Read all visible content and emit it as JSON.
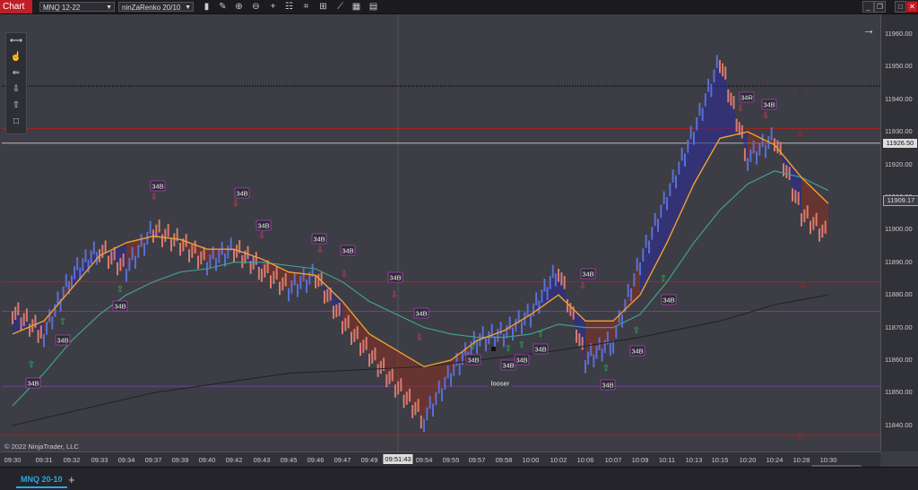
{
  "toolbar": {
    "chart_tab": "Chart",
    "instrument": "MNQ 12-22",
    "bar_type": "ninZaRenko 20/10"
  },
  "icons": [
    "bars-icon",
    "pencil-icon",
    "zoom-in-icon",
    "zoom-out-icon",
    "crosshair-icon",
    "properties-icon",
    "indicators-icon",
    "strategies-icon",
    "drawing-tools-icon",
    "templates-icon",
    "data-box-icon"
  ],
  "window": {
    "minimize": "_",
    "restore": "❐",
    "maximize": "□",
    "close": "✕"
  },
  "drawing_tools": [
    "line-tool-icon",
    "hand-tool-icon",
    "horizontal-line-icon",
    "arrow-down-icon",
    "arrow-up-icon",
    "rectangle-icon"
  ],
  "price_axis": {
    "labels": [
      "11960.00",
      "11950.00",
      "11940.00",
      "11930.00",
      "11920.00",
      "11910.00",
      "11900.00",
      "11890.00",
      "11880.00",
      "11870.00",
      "11860.00",
      "11850.00",
      "11840.00"
    ],
    "crosshair_price": "11926.50",
    "current_price": "11909.17"
  },
  "time_axis": {
    "labels": [
      "09:30",
      "09:31",
      "09:32",
      "09:33",
      "09:34",
      "09:37",
      "09:39",
      "09:40",
      "09:42",
      "09:43",
      "09:45",
      "09:46",
      "09:47",
      "09:49",
      "09:54",
      "09:55",
      "09:57",
      "09:58",
      "10:00",
      "10:02",
      "10:06",
      "10:07",
      "10:09",
      "10:11",
      "10:13",
      "10:15",
      "10:20",
      "10:24",
      "10:28",
      "10:30"
    ],
    "crosshair_time": "09:51:43"
  },
  "signal_labels": [
    "34B",
    "34R",
    "looser"
  ],
  "line_labels": [
    "R",
    "R",
    "R",
    "R"
  ],
  "copyright": "© 2022 NinjaTrader, LLC",
  "f_label": "F",
  "bottom_tab": "MNQ 20-10",
  "add_tab": "+",
  "chart_data": {
    "type": "line",
    "x": [
      "09:30",
      "09:31",
      "09:32",
      "09:33",
      "09:34",
      "09:37",
      "09:39",
      "09:40",
      "09:42",
      "09:43",
      "09:45",
      "09:46",
      "09:47",
      "09:49",
      "09:54",
      "09:55",
      "09:57",
      "09:58",
      "10:00",
      "10:02",
      "10:06",
      "10:07",
      "10:09",
      "10:11",
      "10:13",
      "10:15",
      "10:20",
      "10:24",
      "10:28",
      "10:30"
    ],
    "ylim": [
      11832,
      11966
    ],
    "price": [
      [
        "09:30",
        11875
      ],
      [
        "09:31",
        11868
      ],
      [
        "09:32",
        11886
      ],
      [
        "09:33",
        11894
      ],
      [
        "09:34",
        11888
      ],
      [
        "09:37",
        11900
      ],
      [
        "09:39",
        11896
      ],
      [
        "09:40",
        11890
      ],
      [
        "09:42",
        11894
      ],
      [
        "09:43",
        11888
      ],
      [
        "09:45",
        11882
      ],
      [
        "09:46",
        11886
      ],
      [
        "09:47",
        11872
      ],
      [
        "09:49",
        11862
      ],
      [
        "09:54",
        11842
      ],
      [
        "09:55",
        11856
      ],
      [
        "09:57",
        11866
      ],
      [
        "09:58",
        11868
      ],
      [
        "10:00",
        11874
      ],
      [
        "10:02",
        11888
      ],
      [
        "10:06",
        11860
      ],
      [
        "10:07",
        11866
      ],
      [
        "10:09",
        11890
      ],
      [
        "10:11",
        11910
      ],
      [
        "10:13",
        11930
      ],
      [
        "10:15",
        11952
      ],
      [
        "10:20",
        11922
      ],
      [
        "10:24",
        11928
      ],
      [
        "10:28",
        11905
      ],
      [
        "10:30",
        11898
      ]
    ],
    "ema_fast": [
      [
        "09:30",
        11868
      ],
      [
        "09:31",
        11872
      ],
      [
        "09:32",
        11882
      ],
      [
        "09:33",
        11892
      ],
      [
        "09:34",
        11896
      ],
      [
        "09:37",
        11898
      ],
      [
        "09:39",
        11897
      ],
      [
        "09:40",
        11894
      ],
      [
        "09:42",
        11894
      ],
      [
        "09:43",
        11891
      ],
      [
        "09:45",
        11887
      ],
      [
        "09:46",
        11886
      ],
      [
        "09:47",
        11878
      ],
      [
        "09:49",
        11868
      ],
      [
        "09:54",
        11858
      ],
      [
        "09:55",
        11860
      ],
      [
        "09:57",
        11866
      ],
      [
        "09:58",
        11869
      ],
      [
        "10:00",
        11874
      ],
      [
        "10:02",
        11880
      ],
      [
        "10:06",
        11872
      ],
      [
        "10:07",
        11872
      ],
      [
        "10:09",
        11880
      ],
      [
        "10:11",
        11896
      ],
      [
        "10:13",
        11914
      ],
      [
        "10:15",
        11928
      ],
      [
        "10:20",
        11930
      ],
      [
        "10:24",
        11926
      ],
      [
        "10:28",
        11916
      ],
      [
        "10:30",
        11908
      ]
    ],
    "ema_slow": [
      [
        "09:30",
        11846
      ],
      [
        "09:31",
        11856
      ],
      [
        "09:32",
        11866
      ],
      [
        "09:33",
        11874
      ],
      [
        "09:34",
        11880
      ],
      [
        "09:37",
        11884
      ],
      [
        "09:39",
        11887
      ],
      [
        "09:40",
        11888
      ],
      [
        "09:42",
        11890
      ],
      [
        "09:43",
        11890
      ],
      [
        "09:45",
        11889
      ],
      [
        "09:46",
        11888
      ],
      [
        "09:47",
        11884
      ],
      [
        "09:49",
        11878
      ],
      [
        "09:54",
        11870
      ],
      [
        "09:55",
        11868
      ],
      [
        "09:57",
        11867
      ],
      [
        "09:58",
        11867
      ],
      [
        "10:00",
        11868
      ],
      [
        "10:02",
        11871
      ],
      [
        "10:06",
        11870
      ],
      [
        "10:07",
        11870
      ],
      [
        "10:09",
        11874
      ],
      [
        "10:11",
        11884
      ],
      [
        "10:13",
        11896
      ],
      [
        "10:15",
        11906
      ],
      [
        "10:20",
        11914
      ],
      [
        "10:24",
        11918
      ],
      [
        "10:28",
        11916
      ],
      [
        "10:30",
        11912
      ]
    ],
    "sma_long": [
      [
        "09:30",
        11840
      ],
      [
        "09:37",
        11850
      ],
      [
        "09:45",
        11856
      ],
      [
        "09:54",
        11858
      ],
      [
        "10:02",
        11863
      ],
      [
        "10:09",
        11867
      ],
      [
        "10:15",
        11872
      ],
      [
        "10:24",
        11877
      ],
      [
        "10:30",
        11880
      ]
    ],
    "hlines": [
      {
        "value": 11944,
        "color": "#111111",
        "style": "dotted"
      },
      {
        "value": 11931,
        "color": "#b02020",
        "style": "solid"
      },
      {
        "value": 11926.5,
        "color": "#cccccc",
        "style": "solid"
      },
      {
        "value": 11884,
        "color": "#b02020",
        "style": "solid"
      },
      {
        "value": 11875,
        "color": "#7a3fa0",
        "style": "solid"
      },
      {
        "value": 11837,
        "color": "#b02020",
        "style": "solid"
      },
      {
        "value": 11852,
        "color": "#7a3fa0",
        "style": "solid"
      }
    ],
    "colors": {
      "up": "#5a6fd6",
      "down": "#d97b6c",
      "ema_fast": "#f0a030",
      "ema_slow": "#40a090",
      "sma_long": "#222222",
      "fill_up": "#2a2a9a",
      "fill_down": "#8a3020"
    }
  }
}
